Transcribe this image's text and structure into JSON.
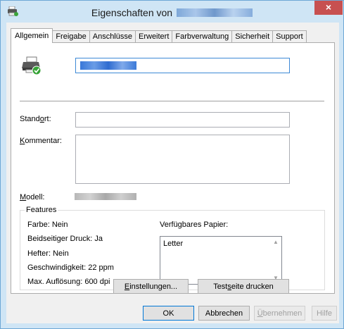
{
  "window": {
    "title_prefix": "Eigenschaften von",
    "close_glyph": "×"
  },
  "tabs": [
    {
      "label": "Allgemein"
    },
    {
      "label": "Freigabe"
    },
    {
      "label": "Anschlüsse"
    },
    {
      "label": "Erweitert"
    },
    {
      "label": "Farbverwaltung"
    },
    {
      "label": "Sicherheit"
    },
    {
      "label": "Support"
    }
  ],
  "general": {
    "location_label_pre": "Stand",
    "location_label_ul": "o",
    "location_label_post": "rt:",
    "comment_label_ul": "K",
    "comment_label_post": "ommentar:",
    "model_label_ul": "M",
    "model_label_post": "odell:",
    "location_value": "",
    "comment_value": ""
  },
  "features": {
    "legend": "Features",
    "color": "Farbe: Nein",
    "duplex": "Beidseitiger Druck: Ja",
    "staple": "Hefter: Nein",
    "speed": "Geschwindigkeit: 22 ppm",
    "resolution": "Max. Auflösung: 600 dpi",
    "paper_label": "Verfügbares Papier:",
    "paper_items": [
      "Letter"
    ]
  },
  "buttons": {
    "settings_ul": "E",
    "settings_post": "instellungen...",
    "test_pre": "Test",
    "test_ul": "s",
    "test_post": "eite drucken",
    "ok": "OK",
    "cancel": "Abbrechen",
    "apply_ul": "Ü",
    "apply_post": "bernehmen",
    "help": "Hilfe"
  },
  "colors": {
    "accent": "#3d89d6",
    "close": "#c75050",
    "frame": "#cfe5f5"
  }
}
